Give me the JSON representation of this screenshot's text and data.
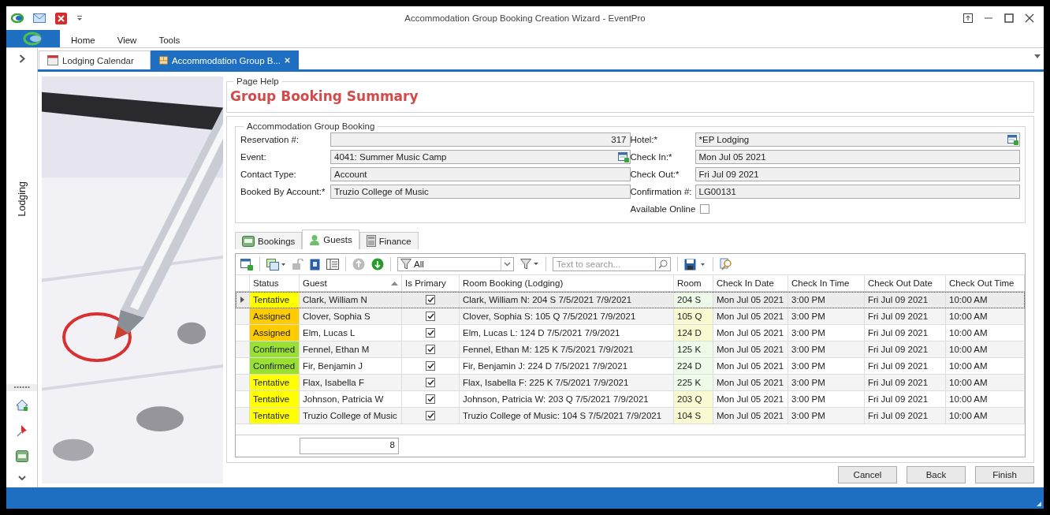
{
  "window": {
    "title": "Accommodation Group Booking Creation Wizard - EventPro"
  },
  "ribbon_tabs": [
    "Home",
    "View",
    "Tools"
  ],
  "doc_tabs": [
    {
      "label": "Lodging Calendar",
      "selected": false,
      "closable": false
    },
    {
      "label": "Accommodation Group B...",
      "selected": true,
      "closable": true
    }
  ],
  "side_panel": {
    "label": "Lodging"
  },
  "page_help": {
    "legend": "Page Help",
    "heading": "Group Booking Summary"
  },
  "booking": {
    "legend": "Accommodation Group Booking",
    "left_fields": [
      {
        "label": "Reservation #:",
        "value": "317",
        "numeric": true,
        "lookup": false
      },
      {
        "label": "Event:",
        "value": "4041: Summer Music Camp",
        "numeric": false,
        "lookup": true
      },
      {
        "label": "Contact Type:",
        "value": "Account",
        "numeric": false,
        "lookup": false
      },
      {
        "label": "Booked By Account:*",
        "value": "Truzio College of Music",
        "numeric": false,
        "lookup": false
      }
    ],
    "right_fields": [
      {
        "label": "Hotel:*",
        "value": "*EP Lodging",
        "numeric": false,
        "lookup": true
      },
      {
        "label": "Check In:*",
        "value": "Mon Jul 05 2021",
        "numeric": false,
        "lookup": false
      },
      {
        "label": "Check Out:*",
        "value": "Fri Jul 09 2021",
        "numeric": false,
        "lookup": false
      },
      {
        "label": "Confirmation #:",
        "value": "LG00131",
        "numeric": false,
        "lookup": false
      }
    ],
    "available_online": {
      "label": "Available Online",
      "checked": false
    }
  },
  "tabs": [
    {
      "label": "Bookings",
      "selected": false,
      "kind": "bed"
    },
    {
      "label": "Guests",
      "selected": true,
      "kind": "person"
    },
    {
      "label": "Finance",
      "selected": false,
      "kind": "calculator"
    }
  ],
  "toolbar": {
    "filter": "All",
    "search_placeholder": "Text to search..."
  },
  "grid": {
    "columns": [
      {
        "label": "Status",
        "sorted": false
      },
      {
        "label": "Guest",
        "sorted": true
      },
      {
        "label": "Is Primary",
        "sorted": false
      },
      {
        "label": "Room Booking (Lodging)",
        "sorted": false
      },
      {
        "label": "Room",
        "sorted": false
      },
      {
        "label": "Check In Date",
        "sorted": false
      },
      {
        "label": "Check In Time",
        "sorted": false
      },
      {
        "label": "Check Out Date",
        "sorted": false
      },
      {
        "label": "Check Out Time",
        "sorted": false
      }
    ],
    "rows": [
      {
        "focused": true,
        "status": "Tentative",
        "color": "#ffff00",
        "guest": "Clark, William N",
        "is_primary": true,
        "room_booking": "Clark, William N: 204 S 7/5/2021 7/9/2021",
        "room": {
          "label": "204 S",
          "color": "#eefbe8"
        },
        "check_in_date": "Mon Jul 05 2021",
        "check_in_time": "3:00 PM",
        "check_out_date": "Fri Jul 09 2021",
        "check_out_time": "10:00 AM"
      },
      {
        "focused": false,
        "status": "Assigned",
        "color": "#ffcc00",
        "guest": "Clover, Sophia S",
        "is_primary": true,
        "room_booking": "Clover, Sophia S: 105 Q 7/5/2021 7/9/2021",
        "room": {
          "label": "105 Q",
          "color": "#fafad2"
        },
        "check_in_date": "Mon Jul 05 2021",
        "check_in_time": "3:00 PM",
        "check_out_date": "Fri Jul 09 2021",
        "check_out_time": "10:00 AM"
      },
      {
        "focused": false,
        "status": "Assigned",
        "color": "#ffcc00",
        "guest": "Elm, Lucas L",
        "is_primary": true,
        "room_booking": "Elm, Lucas L: 124 D 7/5/2021 7/9/2021",
        "room": {
          "label": "124 D",
          "color": "#fafad2"
        },
        "check_in_date": "Mon Jul 05 2021",
        "check_in_time": "3:00 PM",
        "check_out_date": "Fri Jul 09 2021",
        "check_out_time": "10:00 AM"
      },
      {
        "focused": false,
        "status": "Confirmed",
        "color": "#99e033",
        "guest": "Fennel, Ethan M",
        "is_primary": true,
        "room_booking": "Fennel, Ethan M: 125 K 7/5/2021 7/9/2021",
        "room": {
          "label": "125 K",
          "color": "#eefbe8"
        },
        "check_in_date": "Mon Jul 05 2021",
        "check_in_time": "3:00 PM",
        "check_out_date": "Fri Jul 09 2021",
        "check_out_time": "10:00 AM"
      },
      {
        "focused": false,
        "status": "Confirmed",
        "color": "#99e033",
        "guest": "Fir, Benjamin J",
        "is_primary": true,
        "room_booking": "Fir, Benjamin J: 224 D 7/5/2021 7/9/2021",
        "room": {
          "label": "224 D",
          "color": "#eefbe8"
        },
        "check_in_date": "Mon Jul 05 2021",
        "check_in_time": "3:00 PM",
        "check_out_date": "Fri Jul 09 2021",
        "check_out_time": "10:00 AM"
      },
      {
        "focused": false,
        "status": "Tentative",
        "color": "#ffff00",
        "guest": "Flax, Isabella F",
        "is_primary": true,
        "room_booking": "Flax, Isabella F: 225 K 7/5/2021 7/9/2021",
        "room": {
          "label": "225 K",
          "color": "#eefbe8"
        },
        "check_in_date": "Mon Jul 05 2021",
        "check_in_time": "3:00 PM",
        "check_out_date": "Fri Jul 09 2021",
        "check_out_time": "10:00 AM"
      },
      {
        "focused": false,
        "status": "Tentative",
        "color": "#ffff00",
        "guest": "Johnson, Patricia W",
        "is_primary": true,
        "room_booking": "Johnson, Patricia W: 203 Q 7/5/2021 7/9/2021",
        "room": {
          "label": "203 Q",
          "color": "#fafad2"
        },
        "check_in_date": "Mon Jul 05 2021",
        "check_in_time": "3:00 PM",
        "check_out_date": "Fri Jul 09 2021",
        "check_out_time": "10:00 AM"
      },
      {
        "focused": false,
        "status": "Tentative",
        "color": "#ffff00",
        "guest": "Truzio College of Music",
        "is_primary": true,
        "room_booking": "Truzio College of Music: 104 S 7/5/2021 7/9/2021",
        "room": {
          "label": "104 S",
          "color": "#fafad2"
        },
        "check_in_date": "Mon Jul 05 2021",
        "check_in_time": "3:00 PM",
        "check_out_date": "Fri Jul 09 2021",
        "check_out_time": "10:00 AM"
      }
    ],
    "footer_count": "8"
  },
  "buttons": [
    "Cancel",
    "Back",
    "Finish"
  ]
}
